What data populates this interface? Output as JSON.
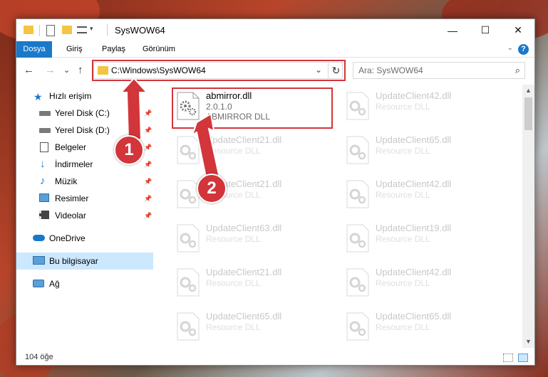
{
  "window": {
    "title": "SysWOW64",
    "controls": {
      "minimize": "—",
      "maximize": "☐",
      "close": "✕"
    }
  },
  "ribbon": {
    "tabs": [
      {
        "label": "Dosya"
      },
      {
        "label": "Giriş"
      },
      {
        "label": "Paylaş"
      },
      {
        "label": "Görünüm"
      }
    ],
    "help": "?"
  },
  "navigation": {
    "back": "←",
    "forward": "→",
    "recent": "⌄",
    "up": "↑",
    "address": "C:\\Windows\\SysWOW64",
    "refresh": "↻",
    "search_placeholder": "Ara: SysWOW64"
  },
  "sidebar": {
    "items": [
      {
        "label": "Hızlı erişim",
        "icon": "star-icon"
      },
      {
        "label": "Yerel Disk (C:)",
        "icon": "drive-icon",
        "pinned": true
      },
      {
        "label": "Yerel Disk (D:)",
        "icon": "drive-icon",
        "pinned": true
      },
      {
        "label": "Belgeler",
        "icon": "documents-icon",
        "pinned": true
      },
      {
        "label": "İndirmeler",
        "icon": "downloads-icon",
        "pinned": true
      },
      {
        "label": "Müzik",
        "icon": "music-icon",
        "pinned": true
      },
      {
        "label": "Resimler",
        "icon": "pictures-icon",
        "pinned": true
      },
      {
        "label": "Videolar",
        "icon": "videos-icon",
        "pinned": true
      },
      {
        "label": "OneDrive",
        "icon": "cloud-icon"
      },
      {
        "label": "Bu bilgisayar",
        "icon": "computer-icon",
        "selected": true
      },
      {
        "label": "Ağ",
        "icon": "network-icon"
      }
    ]
  },
  "files": [
    {
      "name": "abmirror.dll",
      "line2": "2.0.1.0",
      "line3": "ABMIRROR DLL",
      "highlighted": true
    },
    {
      "name": "UpdateClient42.dll",
      "line2": "Resource DLL",
      "line3": ""
    },
    {
      "name": "UpdateClient21.dll",
      "line2": "Resource DLL",
      "line3": ""
    },
    {
      "name": "UpdateClient65.dll",
      "line2": "Resource DLL",
      "line3": ""
    },
    {
      "name": "UpdateClient21.dll",
      "line2": "Resource DLL",
      "line3": ""
    },
    {
      "name": "UpdateClient42.dll",
      "line2": "Resource DLL",
      "line3": ""
    },
    {
      "name": "UpdateClient63.dll",
      "line2": "Resource DLL",
      "line3": ""
    },
    {
      "name": "UpdateClient19.dll",
      "line2": "Resource DLL",
      "line3": ""
    },
    {
      "name": "UpdateClient21.dll",
      "line2": "Resource DLL",
      "line3": ""
    },
    {
      "name": "UpdateClient42.dll",
      "line2": "Resource DLL",
      "line3": ""
    },
    {
      "name": "UpdateClient65.dll",
      "line2": "Resource DLL",
      "line3": ""
    },
    {
      "name": "UpdateClient65.dll",
      "line2": "Resource DLL",
      "line3": ""
    }
  ],
  "status": {
    "count": "104 öğe"
  },
  "annotations": {
    "step1": "1",
    "step2": "2"
  },
  "colors": {
    "accent": "#1979ca",
    "highlight": "#d2353a",
    "selection": "#cce8ff",
    "folder": "#f4c542"
  }
}
